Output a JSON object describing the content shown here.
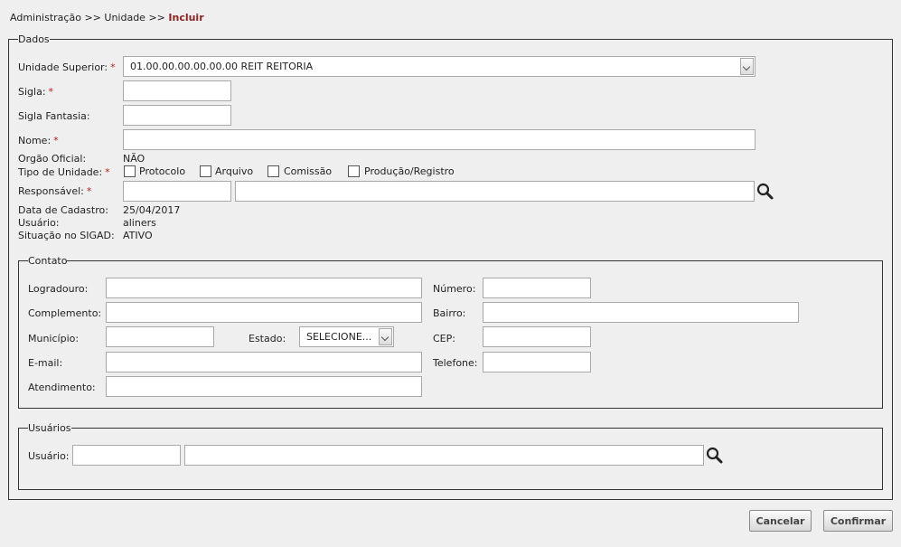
{
  "breadcrumb": {
    "part1": "Administração",
    "sep1": ">>",
    "part2": "Unidade",
    "sep2": ">>",
    "current": "Incluir"
  },
  "dados": {
    "legend": "Dados",
    "unidade_superior_label": "Unidade Superior:",
    "unidade_superior_value": "01.00.00.00.00.00.00 REIT REITORIA",
    "sigla_label": "Sigla:",
    "sigla_fantasia_label": "Sigla Fantasia:",
    "nome_label": "Nome:",
    "orgao_oficial_label": "Orgão Oficial:",
    "orgao_oficial_value": "NÃO",
    "tipo_unidade_label": "Tipo de Unidade:",
    "tipo_options": [
      "Protocolo",
      "Arquivo",
      "Comissão",
      "Produção/Registro"
    ],
    "responsavel_label": "Responsável:",
    "data_cadastro_label": "Data de Cadastro:",
    "data_cadastro_value": "25/04/2017",
    "usuario_label": "Usuário:",
    "usuario_value": "aliners",
    "situacao_label": "Situação no SIGAD:",
    "situacao_value": "ATIVO",
    "required_mark": "*"
  },
  "contato": {
    "legend": "Contato",
    "logradouro_label": "Logradouro:",
    "numero_label": "Número:",
    "complemento_label": "Complemento:",
    "bairro_label": "Bairro:",
    "municipio_label": "Município:",
    "estado_label": "Estado:",
    "estado_value": "SELECIONE...",
    "cep_label": "CEP:",
    "email_label": "E-mail:",
    "telefone_label": "Telefone:",
    "atendimento_label": "Atendimento:"
  },
  "usuarios": {
    "legend": "Usuários",
    "usuario_label": "Usuário:"
  },
  "actions": {
    "cancel_label": "Cancelar",
    "confirm_label": "Confirmar"
  },
  "colors": {
    "background": "#efefef",
    "required": "#b22222",
    "breadcrumb_current": "#8b2323"
  }
}
